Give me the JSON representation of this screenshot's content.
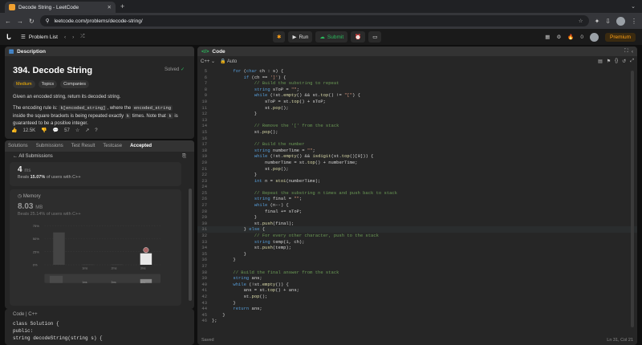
{
  "browser": {
    "tab_title": "Decode String - LeetCode",
    "url": "leetcode.com/problems/decode-string/",
    "new_tab": "+"
  },
  "nav": {
    "problem_list": "Problem List",
    "run": "Run",
    "submit": "Submit",
    "streak": "0",
    "premium": "Premium"
  },
  "description": {
    "tab": "Description",
    "title": "394. Decode String",
    "status": "Solved",
    "tags": [
      "Medium",
      "Topics",
      "Companies"
    ],
    "para1": "Given an encoded string, return its decoded string.",
    "para2_a": "The encoding rule is: ",
    "code_a": "k[encoded_string]",
    "para2_b": ", where the ",
    "code_b": "encoded_string",
    "para2_c": " inside the square brackets is being repeated exactly ",
    "code_k": "k",
    "para2_d": " times. Note that ",
    "para2_e": " is guaranteed to be a positive integer.",
    "likes": "12.5K",
    "comments": "57"
  },
  "submissions": {
    "tabs": [
      "Solutions",
      "Submissions",
      "Test Result",
      "Testcase",
      "Accepted"
    ],
    "all": "All Submissions",
    "runtime_value": "4",
    "runtime_unit": "ms",
    "runtime_beats_a": "Beats ",
    "runtime_beats_pct": "15.07%",
    "runtime_beats_b": " of users with C++",
    "memory_label": "Memory",
    "memory_value": "8.03",
    "memory_unit": "MB",
    "memory_beats": "Beats 25.14% of users with C++"
  },
  "chart_data": {
    "type": "bar",
    "y_ticks": [
      "75%",
      "50%",
      "25%",
      "0%"
    ],
    "x_ticks": [
      "1ms",
      "2ms",
      "3ms"
    ],
    "mini_ticks": [
      "1ms",
      "2ms",
      "3ms"
    ],
    "ylim": [
      0,
      75
    ],
    "bars": [
      {
        "x": "0ms",
        "value": 62
      },
      {
        "x": "1ms",
        "value": 0.5
      },
      {
        "x": "2ms",
        "value": 0.5
      },
      {
        "x": "3ms",
        "value": 22
      }
    ]
  },
  "code_footer": {
    "label": "Code",
    "lang": "C++",
    "line1": "class Solution {",
    "line2": "public:",
    "line3": "    string decodeString(string s) {"
  },
  "editor": {
    "tab": "Code",
    "lang": "C++",
    "mode": "Auto",
    "status": "Saved",
    "position": "Ln 31, Col 21"
  },
  "code_lines": [
    {
      "n": "5",
      "t": "        for (char ch : s) {"
    },
    {
      "n": "6",
      "t": "            if (ch == ']') {"
    },
    {
      "n": "7",
      "t": "                // Build the substring to repeat"
    },
    {
      "n": "8",
      "t": "                string sToP = \"\";"
    },
    {
      "n": "9",
      "t": "                while (!st.empty() && st.top() != \"[\") {"
    },
    {
      "n": "10",
      "t": "                    sToP = st.top() + sToP;"
    },
    {
      "n": "11",
      "t": "                    st.pop();"
    },
    {
      "n": "12",
      "t": "                }"
    },
    {
      "n": "13",
      "t": ""
    },
    {
      "n": "14",
      "t": "                // Remove the '[' from the stack"
    },
    {
      "n": "15",
      "t": "                st.pop();"
    },
    {
      "n": "16",
      "t": ""
    },
    {
      "n": "17",
      "t": "                // Build the number"
    },
    {
      "n": "18",
      "t": "                string numberTime = \"\";"
    },
    {
      "n": "19",
      "t": "                while (!st.empty() && isdigit(st.top()[0])) {"
    },
    {
      "n": "20",
      "t": "                    numberTime = st.top() + numberTime;"
    },
    {
      "n": "21",
      "t": "                    st.pop();"
    },
    {
      "n": "22",
      "t": "                }"
    },
    {
      "n": "23",
      "t": "                int n = stoi(numberTime);"
    },
    {
      "n": "24",
      "t": ""
    },
    {
      "n": "25",
      "t": "                // Repeat the substring n times and push back to stack"
    },
    {
      "n": "26",
      "t": "                string final = \"\";"
    },
    {
      "n": "27",
      "t": "                while (n--) {"
    },
    {
      "n": "28",
      "t": "                    final += sToP;"
    },
    {
      "n": "29",
      "t": "                }"
    },
    {
      "n": "30",
      "t": "                st.push(final);"
    },
    {
      "n": "31",
      "t": "            } else {"
    },
    {
      "n": "32",
      "t": "                // For every other character, push to the stack"
    },
    {
      "n": "33",
      "t": "                string temp(1, ch);"
    },
    {
      "n": "34",
      "t": "                st.push(temp);"
    },
    {
      "n": "35",
      "t": "            }"
    },
    {
      "n": "36",
      "t": "        }"
    },
    {
      "n": "37",
      "t": ""
    },
    {
      "n": "38",
      "t": "        // Build the final answer from the stack"
    },
    {
      "n": "39",
      "t": "        string ans;"
    },
    {
      "n": "40",
      "t": "        while (!st.empty()) {"
    },
    {
      "n": "41",
      "t": "            ans = st.top() + ans;"
    },
    {
      "n": "42",
      "t": "            st.pop();"
    },
    {
      "n": "43",
      "t": "        }"
    },
    {
      "n": "44",
      "t": "        return ans;"
    },
    {
      "n": "45",
      "t": "    }"
    },
    {
      "n": "46",
      "t": "};"
    }
  ]
}
